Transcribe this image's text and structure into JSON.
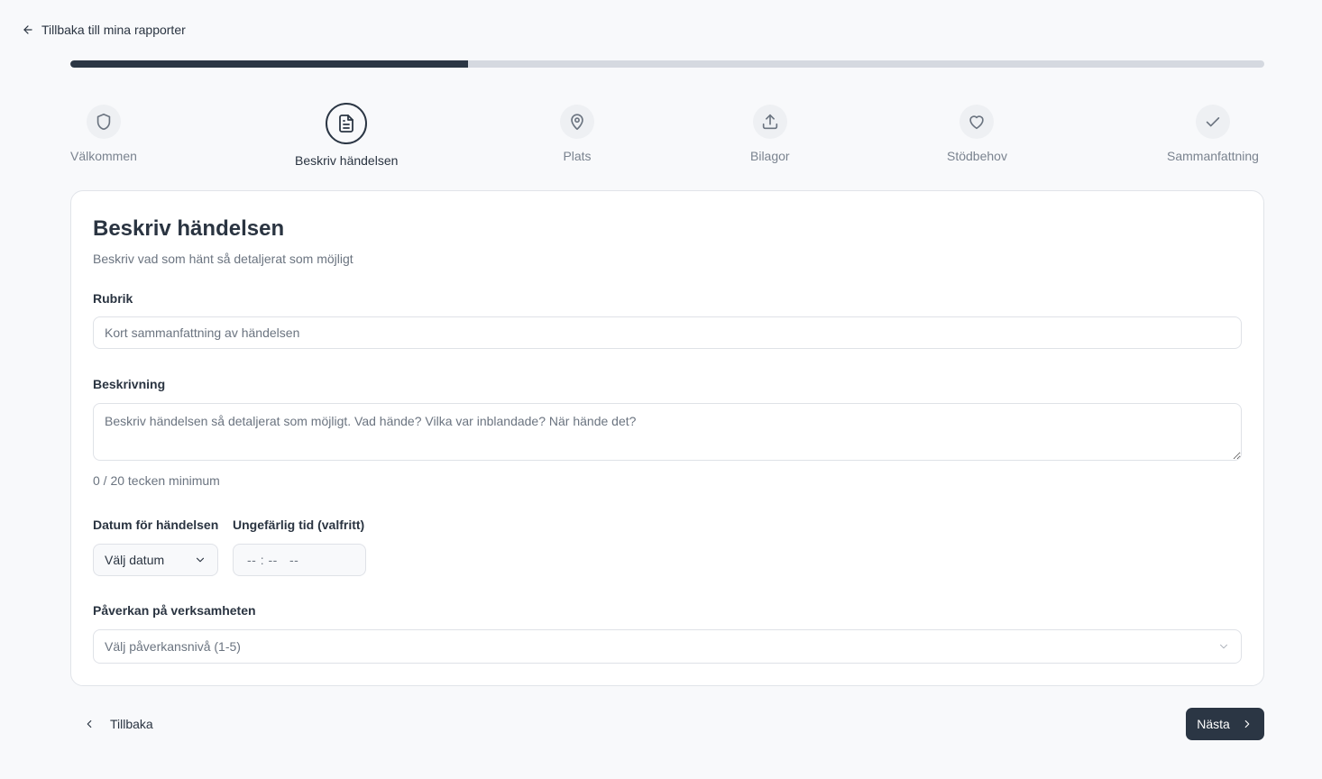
{
  "nav": {
    "back_label": "Tillbaka till mina rapporter"
  },
  "progress": {
    "fraction": 0.333
  },
  "steps": [
    {
      "label": "Välkommen",
      "icon": "shield-icon",
      "active": false
    },
    {
      "label": "Beskriv händelsen",
      "icon": "document-icon",
      "active": true
    },
    {
      "label": "Plats",
      "icon": "map-pin-icon",
      "active": false
    },
    {
      "label": "Bilagor",
      "icon": "upload-icon",
      "active": false
    },
    {
      "label": "Stödbehov",
      "icon": "heart-icon",
      "active": false
    },
    {
      "label": "Sammanfattning",
      "icon": "check-icon",
      "active": false
    }
  ],
  "form": {
    "title": "Beskriv händelsen",
    "subtitle": "Beskriv vad som hänt så detaljerat som möjligt",
    "rubrik": {
      "label": "Rubrik",
      "value": "",
      "placeholder": "Kort sammanfattning av händelsen"
    },
    "beskrivning": {
      "label": "Beskrivning",
      "value": "",
      "placeholder": "Beskriv händelsen så detaljerat som möjligt. Vad hände? Vilka var inblandade? När hände det?"
    },
    "counter": "0 / 20 tecken minimum",
    "datum": {
      "label": "Datum för händelsen",
      "value": "Välj datum"
    },
    "tid": {
      "label": "Ungefärlig tid (valfritt)",
      "value": "-- : --   --"
    },
    "paverkan": {
      "label": "Påverkan på verksamheten",
      "placeholder": "Välj påverkansnivå (1-5)"
    }
  },
  "footer": {
    "back_label": "Tillbaka",
    "next_label": "Nästa"
  },
  "colors": {
    "accent": "#2b3644",
    "background": "#f8f9fb",
    "muted_text": "#6b7480"
  }
}
